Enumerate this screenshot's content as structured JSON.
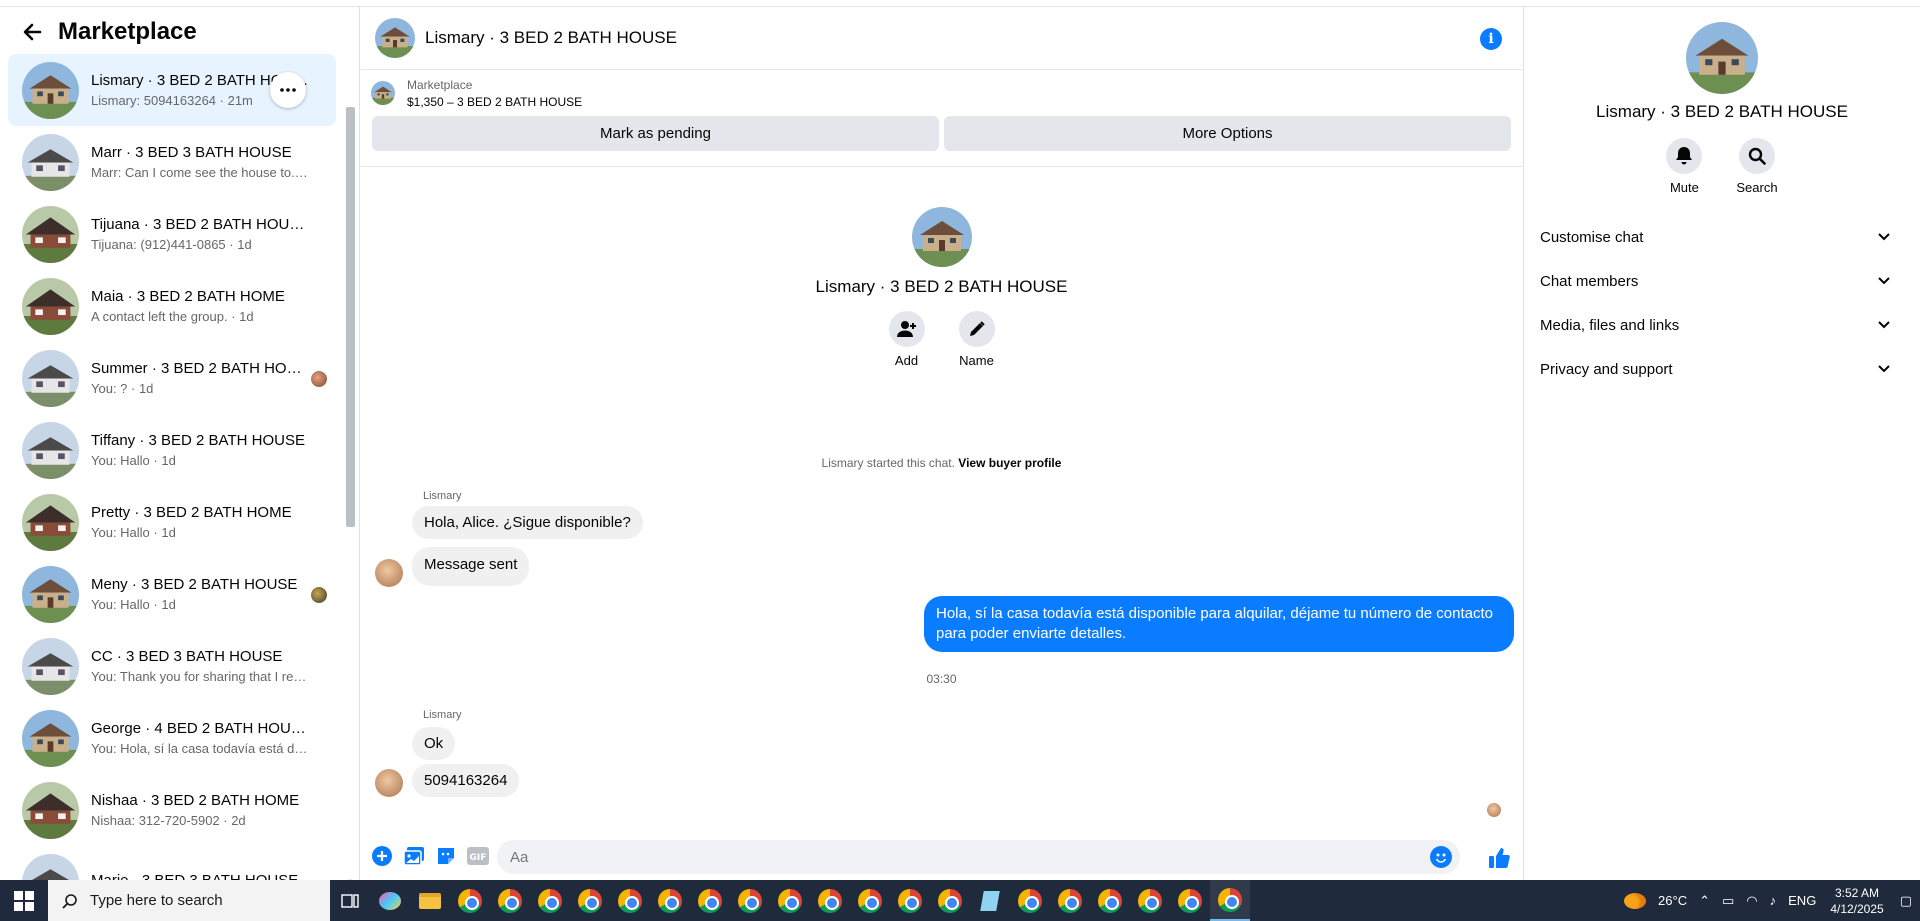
{
  "sidebar": {
    "title": "Marketplace",
    "conversations": [
      {
        "title": "Lismary · 3 BED 2 BATH HOUSE",
        "subtitle": "Lismary: 5094163264 · 21m"
      },
      {
        "title": "Marr · 3 BED 3 BATH HOUSE",
        "subtitle": "Marr: Can I come see the house to... · 1d"
      },
      {
        "title": "Tijuana · 3 BED 2 BATH HOUSE",
        "subtitle": "Tijuana: (912)441-0865 · 1d"
      },
      {
        "title": "Maia · 3 BED 2 BATH HOME",
        "subtitle": "A contact left the group. · 1d"
      },
      {
        "title": "Summer · 3 BED 2 BATH HOU...",
        "subtitle": "You: ? · 1d"
      },
      {
        "title": "Tiffany · 3 BED 2 BATH HOUSE",
        "subtitle": "You: Hallo · 1d"
      },
      {
        "title": "Pretty · 3 BED 2 BATH HOME",
        "subtitle": "You: Hallo · 1d"
      },
      {
        "title": "Meny · 3 BED 2 BATH HOUSE",
        "subtitle": "You: Hallo · 1d"
      },
      {
        "title": "CC · 3 BED 3 BATH HOUSE",
        "subtitle": "You: Thank you for sharing that I re... · 2d"
      },
      {
        "title": "George · 4 BED 2 BATH HOUSE",
        "subtitle": "You: Hola, sí la casa todavía está di... · 2d"
      },
      {
        "title": "Nishaa · 3 BED 2 BATH HOME",
        "subtitle": "Nishaa: 312-720-5902 · 2d"
      },
      {
        "title": "Marie · 3 BED 3 BATH HOUSE",
        "subtitle": ""
      }
    ]
  },
  "chat": {
    "header_title": "Lismary · 3 BED 2 BATH HOUSE",
    "listing_label": "Marketplace",
    "listing_price": "$1,350 – 3 BED 2 BATH HOUSE",
    "mark_pending": "Mark as pending",
    "more_options": "More Options",
    "intro_title": "Lismary · 3 BED 2 BATH HOUSE",
    "intro_add": "Add",
    "intro_name": "Name",
    "started_text": "Lismary started this chat.",
    "view_profile": "View buyer profile",
    "sender1": "Lismary",
    "msg1": "Hola, Alice. ¿Sigue disponible?",
    "msg2": "Message sent",
    "msg_me": "Hola, sí la casa todavía está disponible para alquilar, déjame tu número de contacto para poder enviarte detalles.",
    "time": "03:30",
    "sender2": "Lismary",
    "msg3": "Ok",
    "msg4": "5094163264",
    "composer_placeholder": "Aa"
  },
  "rpanel": {
    "title": "Lismary · 3 BED 2 BATH HOUSE",
    "mute": "Mute",
    "search": "Search",
    "menu": [
      "Customise chat",
      "Chat members",
      "Media, files and links",
      "Privacy and support"
    ]
  },
  "taskbar": {
    "search_placeholder": "Type here to search",
    "temperature": "26°C",
    "language": "ENG",
    "time": "3:52 AM",
    "date": "4/12/2025"
  },
  "colors": {
    "accent": "#0a7cff",
    "active_row": "#e7f3ff",
    "button_bg": "#e4e6eb"
  }
}
